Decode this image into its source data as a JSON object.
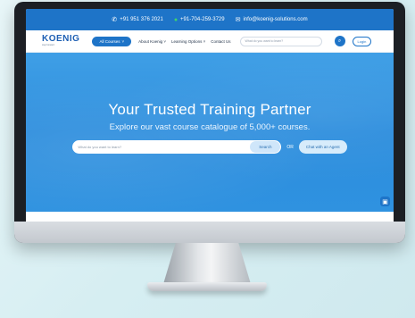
{
  "topbar": {
    "phone_icon": "phone-icon",
    "phone": "+91 951 376 2021",
    "whatsapp_icon": "whatsapp-icon",
    "whatsapp": "+91-704-259-3729",
    "email_icon": "mail-icon",
    "email": "info@koenig-solutions.com"
  },
  "nav": {
    "logo": "KOENIG",
    "logo_sub": "step forward",
    "all_courses": "All Courses",
    "menu": [
      "About Koenig",
      "Learning Options",
      "Contact Us"
    ],
    "search_placeholder": "What do you want to learn?",
    "search_icon": "search-icon",
    "login": "Login"
  },
  "hero": {
    "title": "Your Trusted Training Partner",
    "subtitle": "Explore our vast course catalogue of 5,000+ courses.",
    "search_placeholder": "What do you want to learn?",
    "search_button": "Search",
    "or": "OR",
    "agent_button": "Chat with an Agent"
  },
  "colors": {
    "brand": "#1e74c8",
    "hero": "#2f92e0"
  }
}
